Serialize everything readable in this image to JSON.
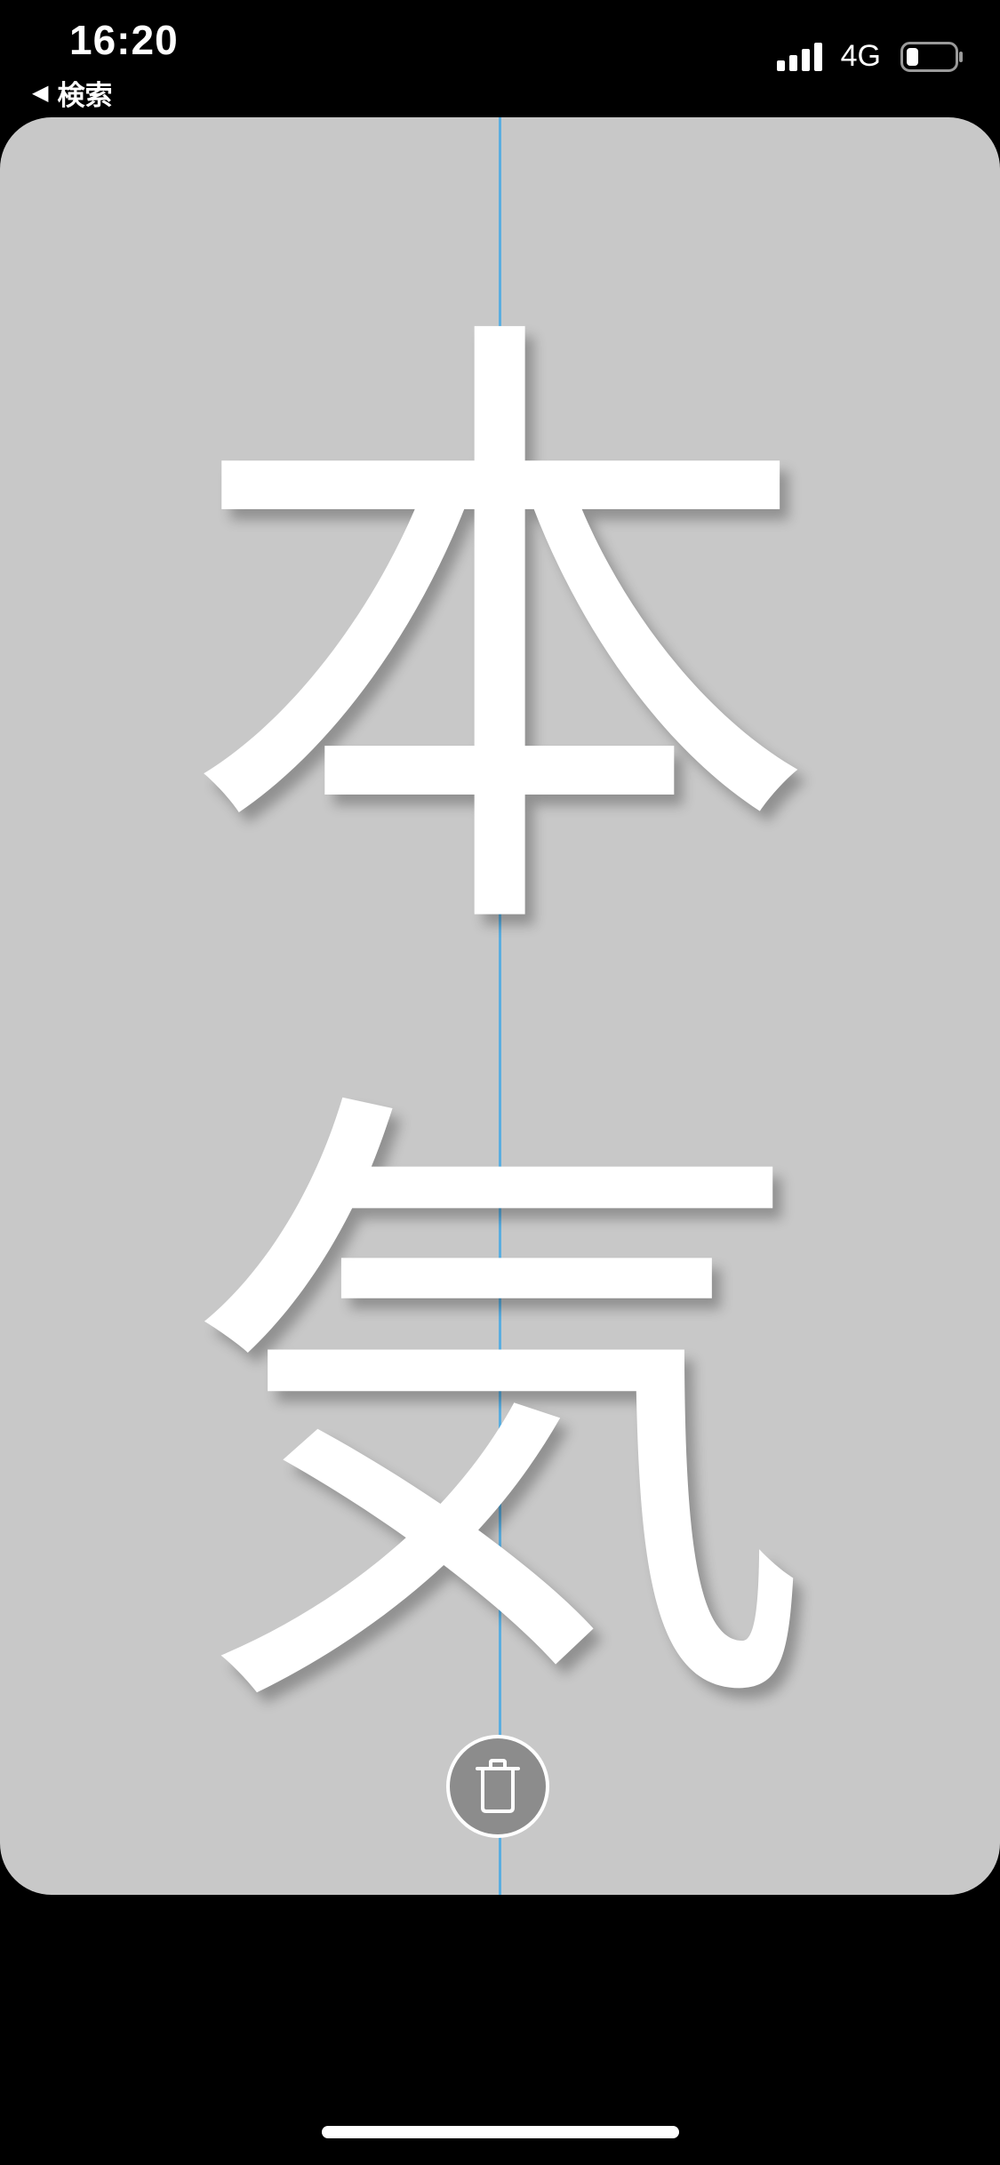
{
  "status_bar": {
    "time": "16:20",
    "back_label": "検索",
    "network": "4G",
    "icons": [
      "signal-icon",
      "battery-icon"
    ]
  },
  "canvas": {
    "text_lines": [
      "本",
      "気"
    ],
    "background_color": "#c8c8c8",
    "text_color": "#ffffff",
    "guide_color": "#5aaee0"
  },
  "controls": {
    "delete_icon": "trash-icon"
  }
}
